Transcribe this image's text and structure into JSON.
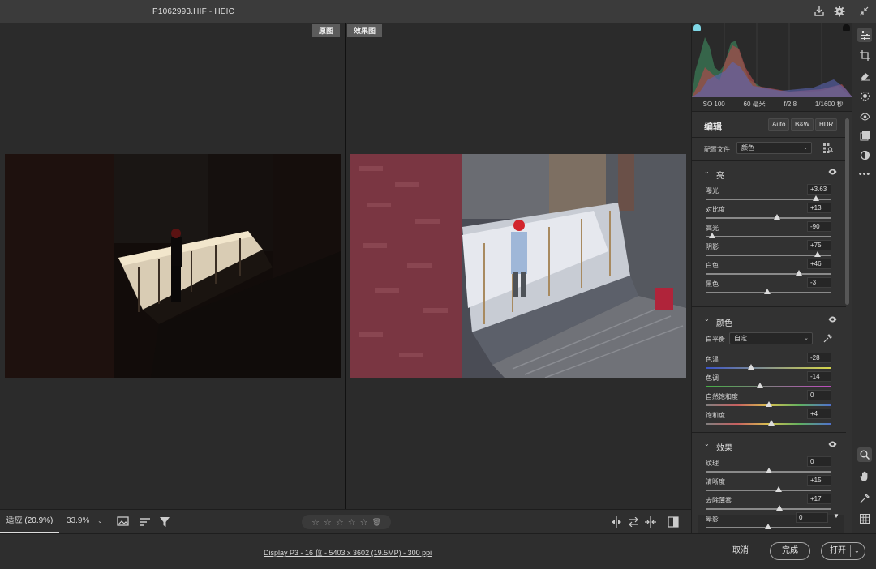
{
  "window": {
    "title": "P1062993.HIF -  HEIC"
  },
  "preview": {
    "before_label": "原图",
    "after_label": "效果图"
  },
  "preview_toolbar": {
    "zoom_fit": "适应 (20.9%)",
    "zoom_percent": "33.9%"
  },
  "exif": {
    "iso": "ISO 100",
    "focal": "60 毫米",
    "aperture": "f/2.8",
    "shutter": "1/1600 秒"
  },
  "edit": {
    "title": "编辑",
    "modes": [
      "Auto",
      "B&W",
      "HDR"
    ],
    "profile_label": "配置文件",
    "profile_value": "颜色"
  },
  "sections": {
    "light": {
      "name": "亮",
      "sliders": [
        {
          "label": "曝光",
          "value": "+3.63",
          "pos": 0.88
        },
        {
          "label": "对比度",
          "value": "+13",
          "pos": 0.57
        },
        {
          "label": "高光",
          "value": "-90",
          "pos": 0.05
        },
        {
          "label": "阴影",
          "value": "+75",
          "pos": 0.89
        },
        {
          "label": "白色",
          "value": "+46",
          "pos": 0.74
        },
        {
          "label": "黑色",
          "value": "-3",
          "pos": 0.49
        }
      ]
    },
    "color": {
      "name": "颜色",
      "wb_label": "白平衡",
      "wb_value": "自定",
      "sliders": [
        {
          "label": "色温",
          "value": "-28",
          "pos": 0.36
        },
        {
          "label": "色调",
          "value": "-14",
          "pos": 0.43
        },
        {
          "label": "自然饱和度",
          "value": "0",
          "pos": 0.5
        },
        {
          "label": "饱和度",
          "value": "+4",
          "pos": 0.52
        }
      ]
    },
    "effects": {
      "name": "效果",
      "sliders": [
        {
          "label": "纹理",
          "value": "0",
          "pos": 0.5
        },
        {
          "label": "清晰度",
          "value": "+15",
          "pos": 0.58
        },
        {
          "label": "去除薄雾",
          "value": "+17",
          "pos": 0.59
        }
      ],
      "vignette": {
        "label": "晕影",
        "value": "0",
        "pos": 0.5
      }
    }
  },
  "statusbar": {
    "info": "Display P3 - 16 位 - 5403 x 3602 (19.5MP) - 300 ppi",
    "cancel": "取消",
    "done": "完成",
    "open": "打开"
  }
}
